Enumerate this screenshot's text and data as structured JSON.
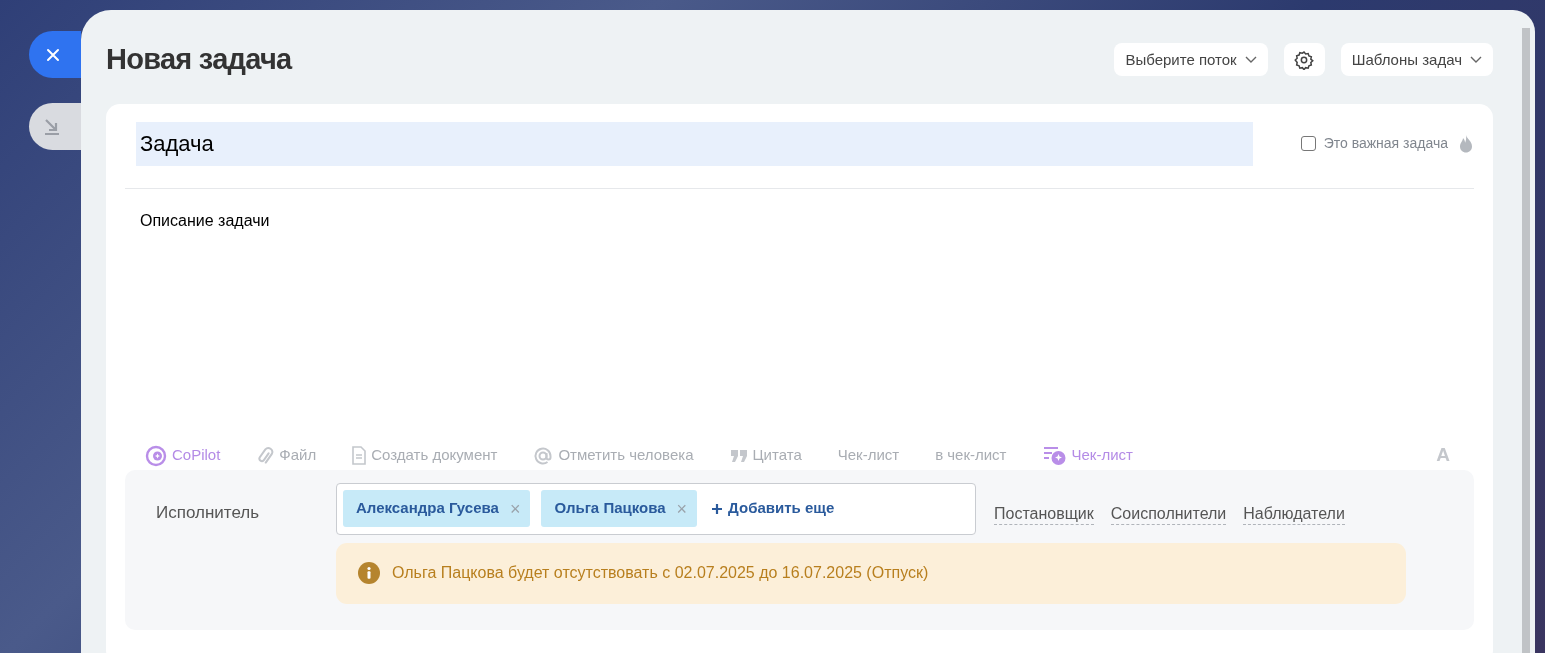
{
  "title": "Новая задача",
  "header_buttons": [
    {
      "kind": "dropdown",
      "label": "Выберите поток"
    },
    {
      "kind": "settings"
    },
    {
      "kind": "dropdown",
      "label": "Шаблоны задач"
    }
  ],
  "task": {
    "title_value": "Задача",
    "important": {
      "label": "Это важная задача",
      "checked": false
    },
    "description": "Описание задачи"
  },
  "toolbar": [
    {
      "kind": "copilot",
      "label": "CoPilot"
    },
    {
      "kind": "file",
      "label": "Файл"
    },
    {
      "kind": "document",
      "label": "Создать документ"
    },
    {
      "kind": "mention",
      "label": "Отметить человека"
    },
    {
      "kind": "quote",
      "label": "Цитата"
    },
    {
      "kind": "plain",
      "label": "Чек-лист"
    },
    {
      "kind": "plain",
      "label": "в чек-лист"
    },
    {
      "kind": "ai-checklist",
      "label": "Чек-лист"
    }
  ],
  "format_button": "A",
  "assignee": {
    "label": "Исполнитель",
    "people": [
      "Александра Гусева",
      "Ольга Пацкова"
    ],
    "remove_glyph": "×",
    "add_label": "Добавить еще",
    "roles": [
      "Постановщик",
      "Соисполнители",
      "Наблюдатели"
    ],
    "warning": "Ольга Пацкова будет отсутствовать с 02.07.2025 до 16.07.2025 (Отпуск)"
  }
}
